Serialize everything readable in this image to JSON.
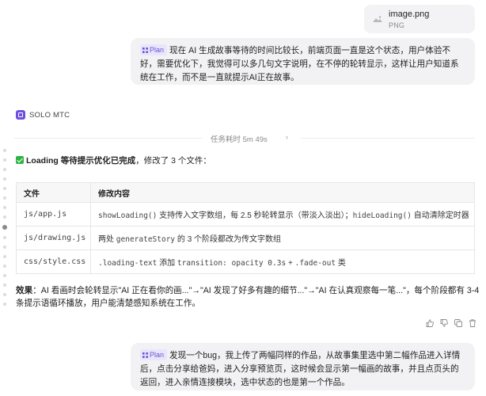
{
  "attachment": {
    "file_name": "image.png",
    "file_type": "PNG",
    "icon": "image-file-icon"
  },
  "messages": [
    {
      "tag": "Plan",
      "text": "现在 AI 生成故事等待的时间比较长，前端页面一直是这个状态，用户体验不好，需要优化下，我觉得可以多几句文字说明，在不停的轮转显示，这样让用户知道系统在工作，而不是一直就提示AI正在故事。"
    },
    {
      "tag": "Plan",
      "text": "发现一个bug，我上传了两幅同样的作品，从故事集里选中第二幅作品进入详情后，点击分享给爸妈，进入分享预览页，这时候会显示第一幅画的故事，并且点页头的返回，进入亲情连接模块，选中状态的也是第一个作品。"
    }
  ],
  "agent": {
    "name": "SOLO MTC"
  },
  "task_duration": {
    "label": "任务耗时 5m 49s",
    "chevron": "›"
  },
  "result": {
    "title": "Loading 等待提示优化已完成",
    "suffix": "，修改了 3 个文件：",
    "table": {
      "headers": [
        "文件",
        "修改内容"
      ],
      "rows": [
        {
          "file": "js/app.js",
          "parts": [
            "showLoading()",
            " 支持传入文字数组，每 2.5 秒轮转显示（带淡入淡出）；",
            "hideLoading()",
            " 自动清除定时器"
          ]
        },
        {
          "file": "js/drawing.js",
          "parts": [
            "两处 ",
            "generateStory",
            " 的 3 个阶段都改为传文字数组"
          ]
        },
        {
          "file": "css/style.css",
          "parts": [
            ".loading-text",
            " 添加 ",
            "transition: opacity 0.3s",
            " + ",
            ".fade-out",
            " 类"
          ]
        }
      ]
    },
    "effect_label": "效果",
    "effect_text": "：AI 看画时会轮转显示\"AI 正在看你的画...\"→\"AI 发现了好多有趣的细节...\"→\"AI 在认真观察每一笔...\"，每个阶段都有 3-4 条提示语循环播放，用户能清楚感知系统在工作。"
  },
  "actions": [
    "thumbs-up-icon",
    "thumbs-down-icon",
    "copy-icon",
    "delete-icon"
  ],
  "colors": {
    "accent": "#6b54d8",
    "tag_bg": "#e9e5fb",
    "success": "#2fb344",
    "bubble_bg": "#f2f2f4"
  }
}
